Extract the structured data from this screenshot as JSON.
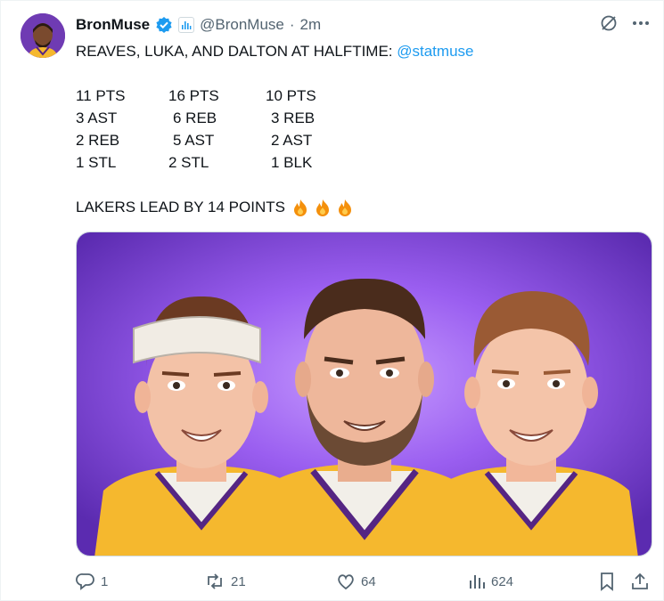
{
  "author": {
    "display_name": "BronMuse",
    "handle": "@BronMuse",
    "separator": "·",
    "timestamp": "2m"
  },
  "tweet": {
    "headline": "REAVES, LUKA, AND DALTON AT HALFTIME: ",
    "mention": "@statmuse",
    "stats": {
      "reaves": [
        "11 PTS",
        "3 AST",
        "2 REB",
        "1 STL"
      ],
      "luka": [
        "16 PTS",
        "6 REB",
        "5 AST",
        "2 STL"
      ],
      "dalton": [
        "10 PTS",
        "3 REB",
        "2 AST",
        "1 BLK"
      ]
    },
    "footer_line": "LAKERS LEAD BY 14 POINTS"
  },
  "actions": {
    "replies": "1",
    "reposts": "21",
    "likes": "64",
    "views": "624"
  },
  "icons": {
    "verified": "verified-badge-icon",
    "affiliate": "statmuse-affiliate-icon",
    "grok": "grok-icon",
    "more": "more-options-icon",
    "reply": "reply-icon",
    "repost": "repost-icon",
    "like": "heart-icon",
    "views": "views-icon",
    "bookmark": "bookmark-icon",
    "share": "share-icon",
    "fire": "fire-emoji"
  },
  "colors": {
    "link": "#1d9bf0",
    "muted": "#536471",
    "text": "#0f1419",
    "verified": "#1d9bf0",
    "media_bg": "#8a4fe0",
    "jersey_gold": "#f5b82e",
    "jersey_purple": "#552583"
  }
}
